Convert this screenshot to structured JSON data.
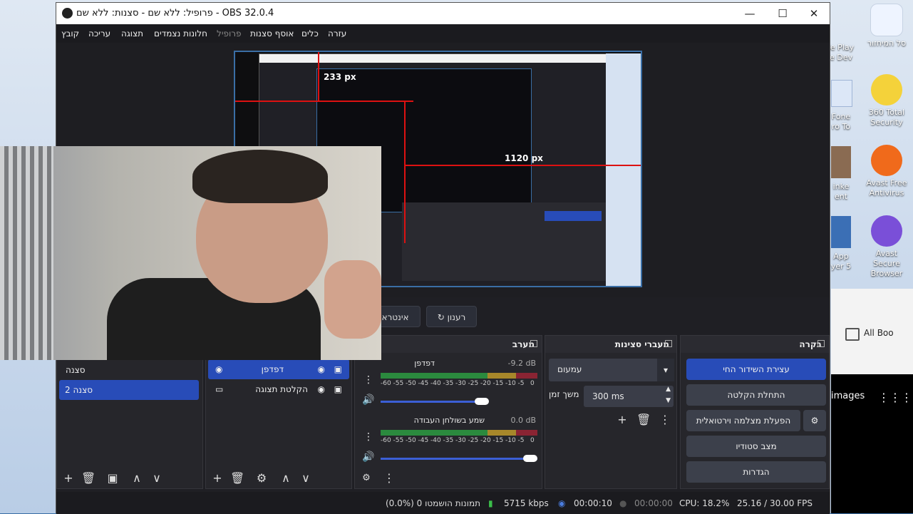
{
  "window": {
    "title": "OBS 32.0.4 - פרופיל: ללא שם - סצנות: ללא שם",
    "minimize": "—",
    "maximize": "☐",
    "close": "✕"
  },
  "menu": [
    "קובץ",
    "עריכה",
    "תצוגה",
    "חלונות נצמדים",
    "פרופיל",
    "אוסף סצנות",
    "כלים",
    "עזרה"
  ],
  "preview_labels": {
    "height_marker": "233 px",
    "width_marker": "1120 px"
  },
  "controls": {
    "refresh_label": "רענון",
    "interact_label": "אינטרא"
  },
  "scenes": {
    "title": "סצנה",
    "items": [
      "סצנה",
      "סצנה 2"
    ]
  },
  "sources": {
    "items": [
      "דפדפן",
      "הקלטת תצוגה"
    ]
  },
  "mixer": {
    "title": "מערב",
    "channels": [
      {
        "name": "דפדפן",
        "db": "-9.2 dB",
        "level": 0.76,
        "volume": 0.9
      },
      {
        "name": "שמע בשולחן העבודה",
        "db": "0.0 dB",
        "level": 0.0,
        "volume": 1.0
      }
    ],
    "scale": [
      "-60",
      "-55",
      "-50",
      "-45",
      "-40",
      "-35",
      "-30",
      "-25",
      "-20",
      "-15",
      "-10",
      "-5",
      "0"
    ]
  },
  "transitions": {
    "title": "מעברי סצינות",
    "selected": "עמעום",
    "duration_label": "משך זמן",
    "duration_value": "300 ms"
  },
  "controls_dock": {
    "title": "בקרה",
    "buttons": [
      "עצירת השידור החי",
      "התחלת הקלטה",
      "הפעלת מצלמה וירטואלית",
      "מצב סטודיו",
      "הגדרות"
    ]
  },
  "status": {
    "dropped": "(0.0%) 0 תמונות הושמטו",
    "bitrate": "5715 kbps",
    "stream_time": "00:00:10",
    "rec_time": "00:00:00",
    "cpu": "CPU: 18.2%",
    "fps": "25.16 / 30.00 FPS"
  },
  "desktop": {
    "icons": [
      "סל המיחזור",
      "360 Total Security",
      "Avast Free Antivirus",
      "Avast Secure Browser"
    ],
    "partial_labels": [
      "le Play",
      "e Dev",
      "Fone",
      "ro To",
      "inke",
      "ent",
      "App",
      "yer 5"
    ],
    "browser": {
      "bookmark": "All Boo",
      "images": "images"
    }
  },
  "colors": {
    "accent": "#284cb8",
    "meter_green": "#2b8a3e",
    "meter_yellow": "#a7872a",
    "meter_red": "#8a2433"
  }
}
